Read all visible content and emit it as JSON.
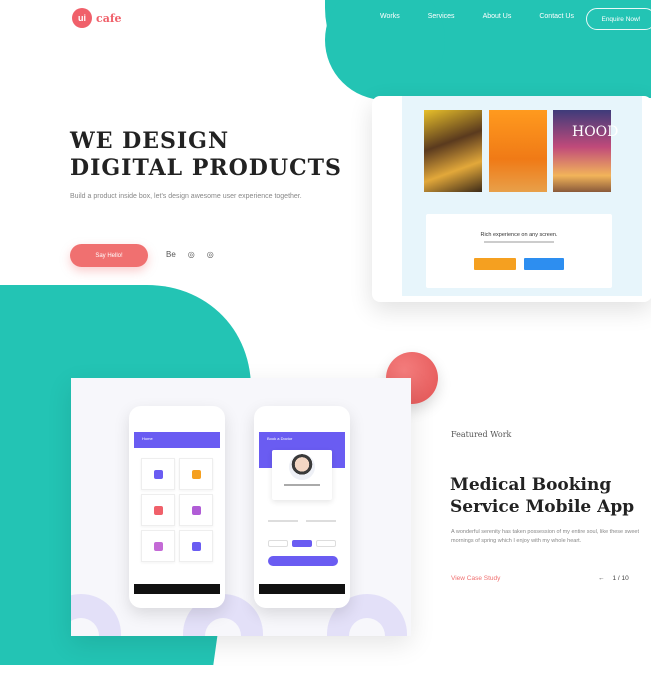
{
  "logo": {
    "mark": "ui",
    "text": "cafe"
  },
  "nav": {
    "items": [
      "Works",
      "Services",
      "About Us",
      "Contact Us"
    ],
    "cta": "Enquire Now!"
  },
  "hero": {
    "title_line1": "WE DESIGN",
    "title_line2": "DIGITAL PRODUCTS",
    "subtitle": "Build a product inside box, let's design awesome user experience together.",
    "button": "Say Hello!",
    "socials": [
      "Be",
      "◎",
      "◎"
    ]
  },
  "preview_card": {
    "book3_title": "HOOD",
    "panel_text": "Rich experience on any screen."
  },
  "phones": {
    "phone1_bar": "Home",
    "phone2_bar": "Book a Doctor"
  },
  "featured": {
    "label": "Featured Work",
    "title_line1": "Medical Booking",
    "title_line2": "Service  Mobile App",
    "description": "A wonderful serenity has taken possession of my entire soul, like these sweet mornings of spring which I enjoy with my whole heart.",
    "link": "View Case Study",
    "pager_prev": "←",
    "pager": "1 / 10"
  },
  "colors": {
    "teal": "#23c4b4",
    "coral": "#f07070",
    "purple": "#6a5cf2"
  }
}
